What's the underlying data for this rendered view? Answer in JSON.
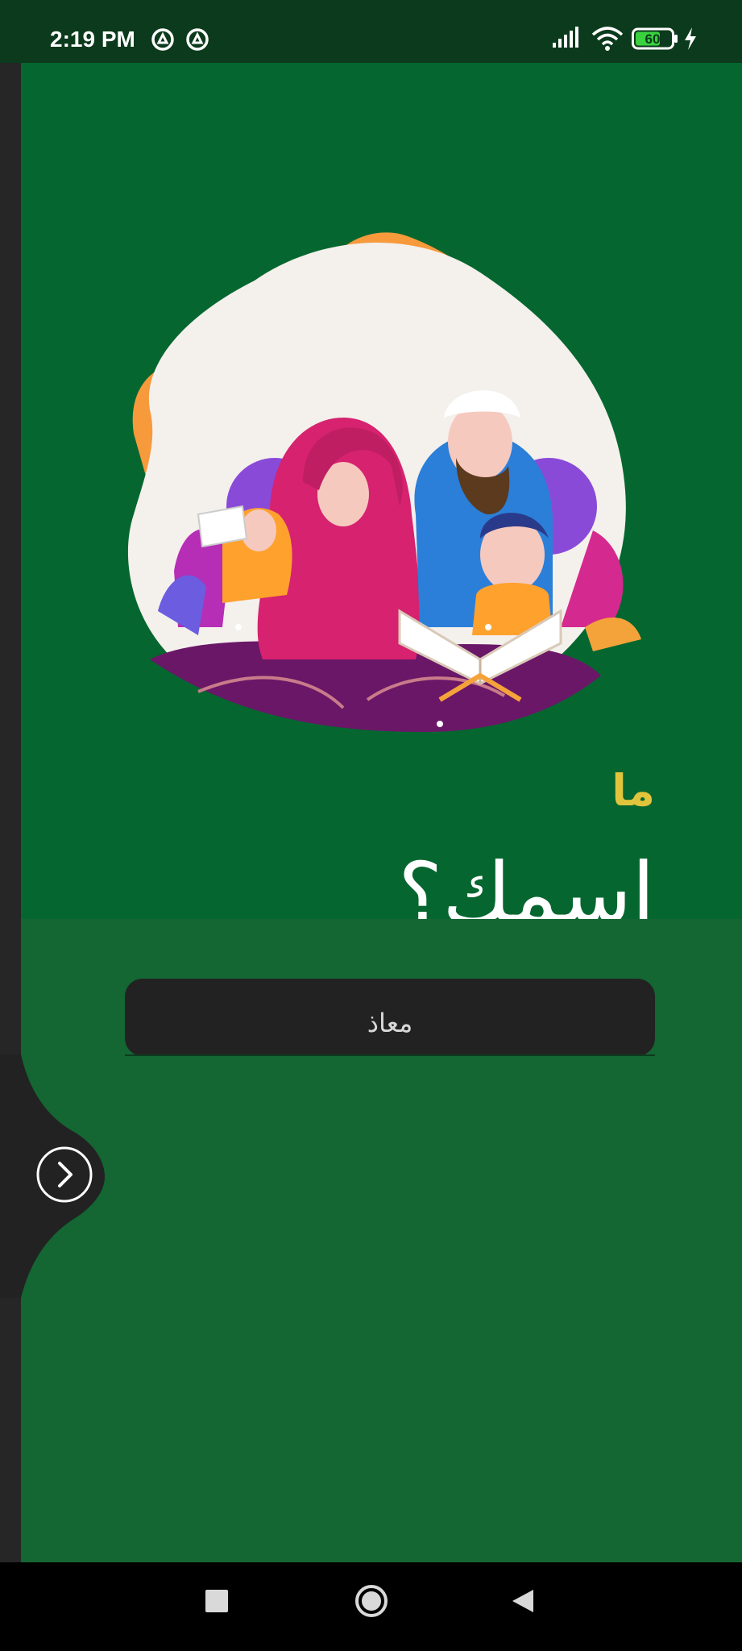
{
  "status_bar": {
    "time": "2:19 PM",
    "battery": "60",
    "icons": [
      "app-notification-icon",
      "app-notification-icon",
      "signal-icon",
      "wifi-icon",
      "battery-icon",
      "charging-icon"
    ]
  },
  "hero": {
    "illustration": "family-reading-quran-illustration",
    "question_small": "ما",
    "question_large": "اسمك؟"
  },
  "form": {
    "name_value": "معاذ"
  },
  "next_button": {
    "icon": "chevron-right-icon"
  },
  "nav_bar": {
    "icons": [
      "recents-square-icon",
      "home-circle-icon",
      "back-triangle-icon"
    ]
  },
  "colors": {
    "hero_background": "#05672f",
    "form_background": "#146633",
    "accent_yellow": "#e0c43c",
    "input_background": "#222222",
    "status_bar": "#0c3a1c"
  }
}
